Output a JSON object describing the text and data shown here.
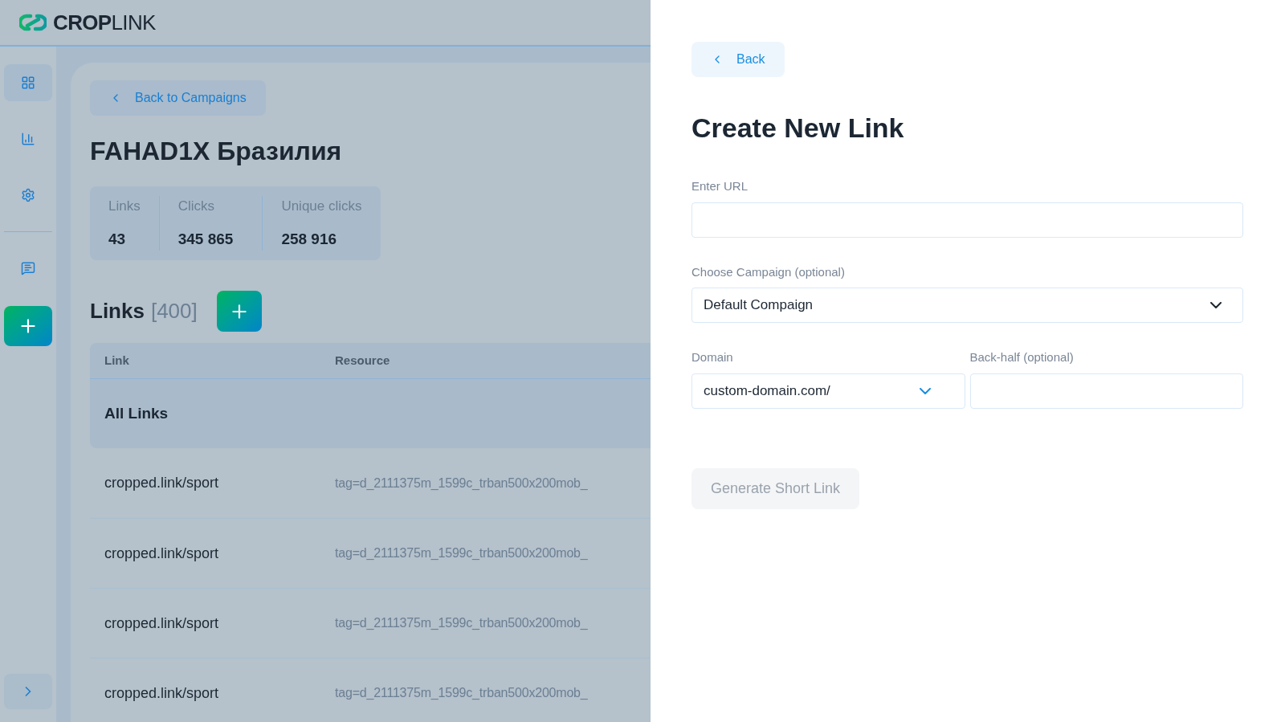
{
  "logo": "**CROP**LINK",
  "sidebar": {
    "items": [
      {
        "selected": true
      },
      {
        "selected": false
      },
      {
        "selected": false
      },
      {
        "selected": false
      }
    ]
  },
  "campaign": {
    "back_label": "Back to Campaigns",
    "title": "FAHAD1X Бразилия",
    "stats": [
      {
        "label": "Links",
        "value": "43"
      },
      {
        "label": "Clicks",
        "value": "345 865"
      },
      {
        "label": "Unique clicks",
        "value": "258 916"
      }
    ]
  },
  "links": {
    "title": "Links",
    "count": "[400]",
    "columns": [
      "Link",
      "Resource"
    ],
    "group": "All Links",
    "rows": [
      {
        "link": "cropped.link/sport",
        "resource": "tag=d_2111375m_1599c_trban500x200mob_"
      },
      {
        "link": "cropped.link/sport",
        "resource": "tag=d_2111375m_1599c_trban500x200mob_"
      },
      {
        "link": "cropped.link/sport",
        "resource": "tag=d_2111375m_1599c_trban500x200mob_"
      },
      {
        "link": "cropped.link/sport",
        "resource": "tag=d_2111375m_1599c_trban500x200mob_"
      }
    ]
  },
  "panel": {
    "back_label": "Back",
    "title": "Create New Link",
    "url": {
      "label": "Enter URL"
    },
    "campaign": {
      "label": "Choose Campaign (optional)",
      "value": "Default Compaign"
    },
    "domain": {
      "label": "Domain",
      "value": "custom-domain.com/"
    },
    "back_half": {
      "label": "Back-half (optional)"
    },
    "submit": {
      "label": "Generate Short Link",
      "disabled": true
    }
  }
}
